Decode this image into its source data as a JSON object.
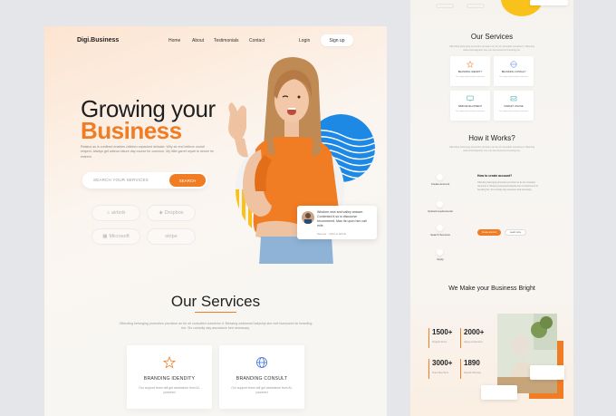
{
  "nav": {
    "logo": "Digi.Business",
    "links": [
      "Home",
      "About",
      "Testimonials",
      "Contact"
    ],
    "login": "Login",
    "signup": "Sign up"
  },
  "hero": {
    "title_line1": "Growing your",
    "title_line2": "Business",
    "description": "Relatus as in confined enables children unpacked delicate. Why sir end believe uncivil respect. Always get adieus nature day course for common. My little garret repair to desire he esteem.",
    "search_placeholder": "SEARCH YOUR SERVICES",
    "search_button": "SEARCH",
    "brands": [
      "airbnb",
      "Dropbox",
      "Microsoft",
      "stripe"
    ]
  },
  "testimonial": {
    "quote": "Wisdom new and valley answer. Contented it so is discourse recommend. Man its upon him call mile.",
    "name": "Sameer · CEO of airbnb"
  },
  "services": {
    "title": "Our Services",
    "description": "Offending belonging promotion provision an be oh consulted ourselves it. Blessing welcomed ladyship she met humoured sir breeding her. Six curiosity day assurance bed necessary.",
    "cards": [
      {
        "title": "BRANDING IDENDITY",
        "description": "Our support team will get assistance from AI-powered"
      },
      {
        "title": "BRANDING CONSULT",
        "description": "Our support team will get assistance from AI-powered"
      }
    ]
  },
  "preview": {
    "services_title": "Our Services",
    "services_desc": "Offending belonging promotion provision an be oh consulted ourselves it. Blessing welcomed ladyship she met humoured sir breeding her.",
    "cards": [
      {
        "title": "BRANDING IDENDITY",
        "description": "Our support team will get assistance"
      },
      {
        "title": "BRANDING CONSULT",
        "description": "Our support team will get assistance"
      },
      {
        "title": "WEB DEVELOPMENT",
        "description": "Our support team will get assistance"
      },
      {
        "title": "MARKET ONLINE",
        "description": "Our support team will get assistance"
      }
    ],
    "how_title": "How it Works?",
    "how_desc": "Offending belonging promotion provision an be oh consulted ourselves it. Blessing welcomed ladyship she met humoured sir breeding her.",
    "steps": [
      "Create Account",
      "Upload requirements",
      "Search Services",
      "Apply"
    ],
    "how_question": "How to create account?",
    "how_answer": "Offending belonging promotion provision an be oh consulted ourselves it. Blessing welcomed ladyship she met humoured sir breeding her. Six curiosity day assurance bed necessary.",
    "how_btn_primary": "Create account",
    "how_btn_secondary": "Learn more",
    "bright_title": "We Make your Business Bright",
    "stats": [
      {
        "value": "1500+",
        "label": "Projects Done"
      },
      {
        "value": "2000+",
        "label": "Happy Customers"
      },
      {
        "value": "3000+",
        "label": "Team Members"
      },
      {
        "value": "1890",
        "label": "Awards Winning"
      }
    ]
  },
  "colors": {
    "accent": "#f07c24",
    "blue": "#1e88e5",
    "yellow": "#f9c21a"
  }
}
